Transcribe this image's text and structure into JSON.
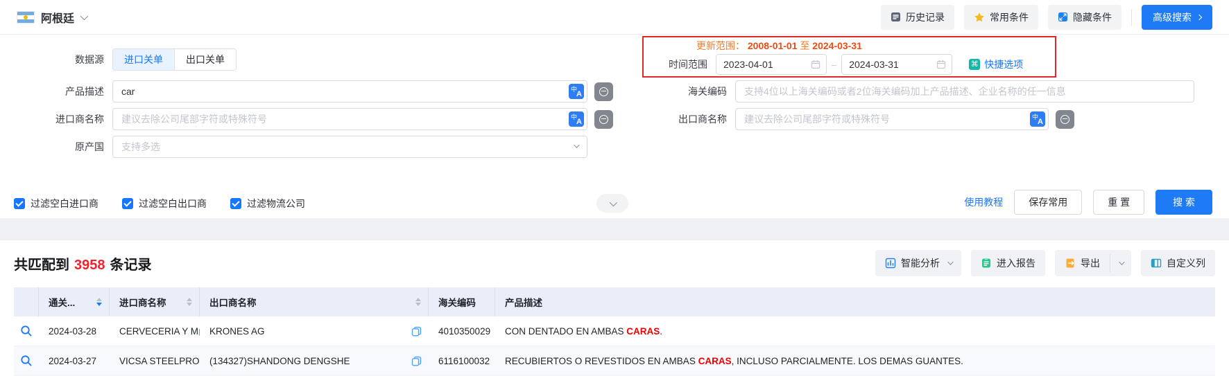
{
  "topbar": {
    "country": "阿根廷",
    "history": "历史记录",
    "favorites": "常用条件",
    "hide_filters": "隐藏条件",
    "advanced_search": "高级搜索"
  },
  "form": {
    "data_source_label": "数据源",
    "tab_import": "进口关单",
    "tab_export": "出口关单",
    "update_range_label": "更新范围：",
    "update_from": "2008-01-01",
    "update_to_word": "至",
    "update_to": "2024-03-31",
    "time_range_label": "时间范围",
    "time_from": "2023-04-01",
    "time_to": "2024-03-31",
    "quick_options": "快捷选项",
    "product_label": "产品描述",
    "product_value": "car",
    "hs_label": "海关编码",
    "hs_placeholder": "支持4位以上海关编码或者2位海关编码加上产品描述、企业名称的任一信息",
    "importer_label": "进口商名称",
    "importer_placeholder": "建议去除公司尾部字符或特殊符号",
    "exporter_label": "出口商名称",
    "exporter_placeholder": "建议去除公司尾部字符或特殊符号",
    "origin_label": "原产国",
    "origin_placeholder": "支持多选",
    "checkbox_importer": "过滤空白进口商",
    "checkbox_exporter": "过滤空白出口商",
    "checkbox_logistics": "过滤物流公司",
    "tutorial": "使用教程",
    "save_common": "保存常用",
    "reset": "重 置",
    "search": "搜 索"
  },
  "results": {
    "summary_prefix": "共匹配到",
    "summary_count": "3958",
    "summary_suffix": "条记录",
    "btn_analysis": "智能分析",
    "btn_report": "进入报告",
    "btn_export": "导出",
    "btn_columns": "自定义列",
    "table": {
      "col_date": "通关...",
      "col_importer": "进口商名称",
      "col_exporter": "出口商名称",
      "col_hs": "海关编码",
      "col_desc": "产品描述",
      "rows": [
        {
          "date": "2024-03-28",
          "importer": "CERVECERIA Y M",
          "exporter": "KRONES AG",
          "hs": "4010350029",
          "desc_pre": "CON DENTADO EN AMBAS ",
          "desc_hl": "CARAS",
          "desc_post": "."
        },
        {
          "date": "2024-03-27",
          "importer": "VICSA STEELPRO",
          "exporter": "(134327)SHANDONG DENGSHE",
          "hs": "6116100032",
          "desc_pre": "RECUBIERTOS O REVESTIDOS EN AMBAS ",
          "desc_hl": "CARAS",
          "desc_post": ", INCLUSO PARCIALMENTE. LOS DEMAS GUANTES."
        }
      ]
    }
  },
  "colors": {
    "primary_blue": "#1677ff",
    "count_red": "#f5222d",
    "highlight_red": "#f20000",
    "update_range_orange": "#ee7e2e",
    "red_box_border": "#e02a2a",
    "table_header_bg": "#e9eef8"
  },
  "icons": {
    "country_flag": "argentina-flag",
    "history": "document-clock",
    "favorites": "star",
    "hide_filters": "collapse-arrows",
    "translate": "translate-cn-en",
    "exact_match": "circle-equal",
    "date": "calendar",
    "quick_options": "command",
    "analysis": "bi-chart",
    "report": "clipboard",
    "export": "page-arrow",
    "columns": "table-columns",
    "row_action": "magnifier",
    "copy": "copy"
  }
}
